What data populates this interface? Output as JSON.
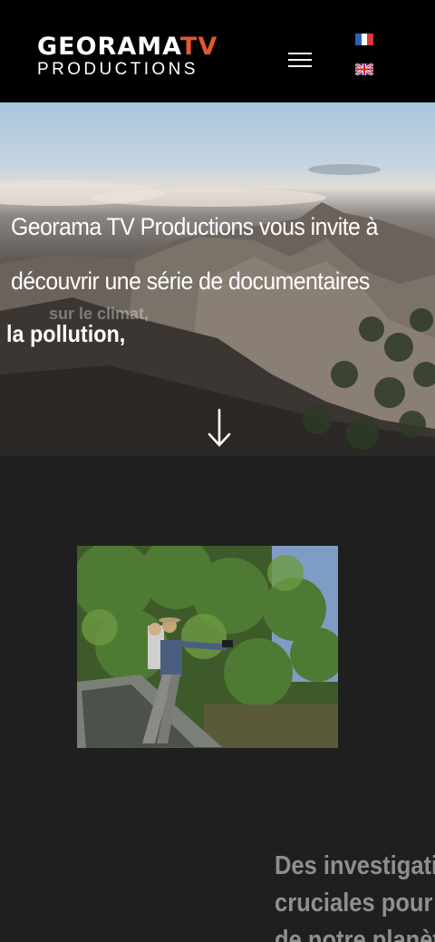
{
  "header": {
    "logo_main": "GEORAMA",
    "logo_accent": "TV",
    "logo_sub": "PRODUCTIONS",
    "menu_icon": "hamburger-menu-icon",
    "languages": [
      {
        "code": "fr",
        "icon": "flag-france-icon"
      },
      {
        "code": "en",
        "icon": "flag-uk-icon"
      }
    ]
  },
  "hero": {
    "line1": "Georama TV Productions vous invite à",
    "line2": "découvrir une série de documentaires",
    "ghost_text": "sur le climat,",
    "keyword": "la pollution,",
    "scroll_icon": "arrow-down-icon"
  },
  "section": {
    "heading_lines": [
      "Des investigati",
      "cruciales pour",
      "de notre planèt"
    ]
  },
  "colors": {
    "header_bg": "#000000",
    "accent": "#e4572e",
    "dark_bg": "#1f1f1f",
    "heading_gray": "#8f8f8f"
  }
}
